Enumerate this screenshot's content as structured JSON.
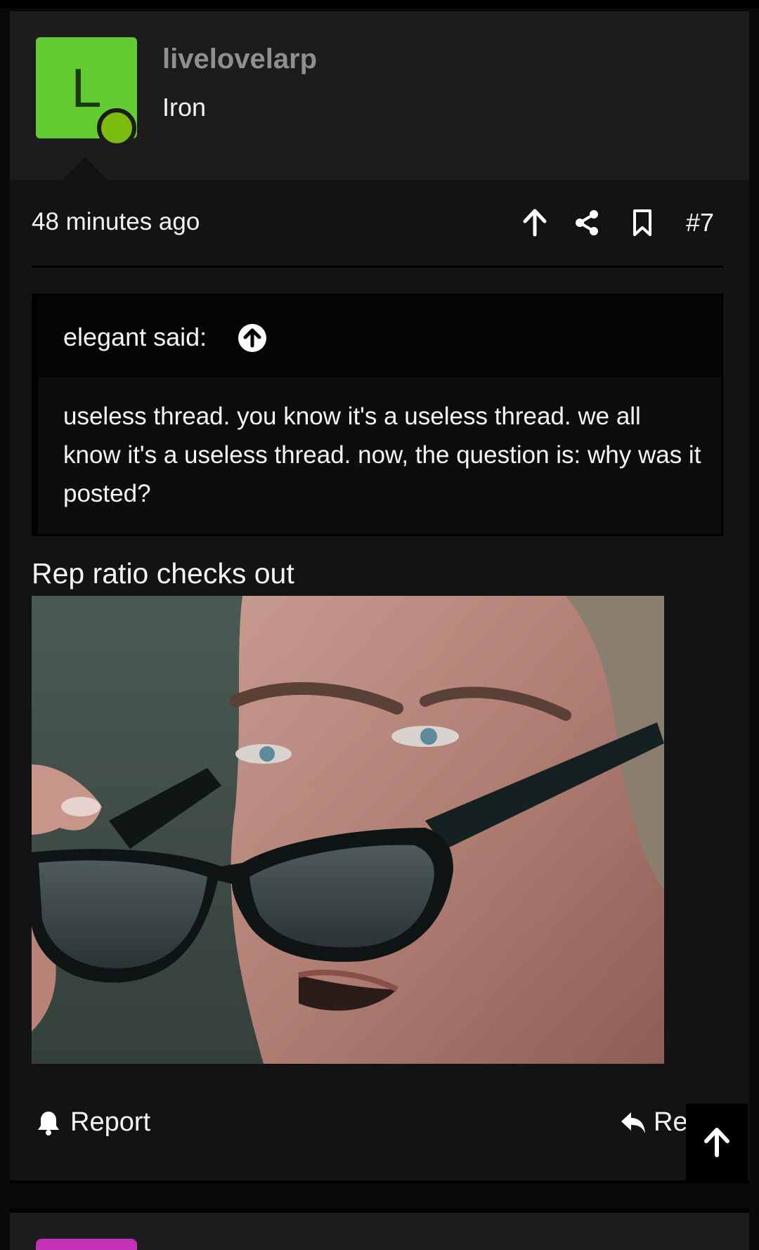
{
  "post": {
    "author": {
      "avatar_letter": "L",
      "avatar_color": "#64cc33",
      "username": "livelovelarp",
      "rank": "Iron",
      "online": true
    },
    "timestamp": "48 minutes ago",
    "actions": {
      "upvote_icon": "arrow-up-icon",
      "share_icon": "share-icon",
      "bookmark_icon": "bookmark-icon",
      "post_number": "#7"
    },
    "quote": {
      "author_label": "elegant said:",
      "jump_icon": "circle-arrow-up-icon",
      "text": "useless thread. you know it's a useless thread. we all know it's a useless thread. now, the question is: why was it posted?"
    },
    "body_text": "Rep ratio checks out",
    "image": {
      "description_icon": "embedded-gif-image"
    },
    "footer": {
      "report_label": "Report",
      "reply_label": "Reply"
    }
  },
  "scroll_to_top_icon": "arrow-up-icon",
  "next_post": {
    "avatar_color": "#c232b8"
  }
}
